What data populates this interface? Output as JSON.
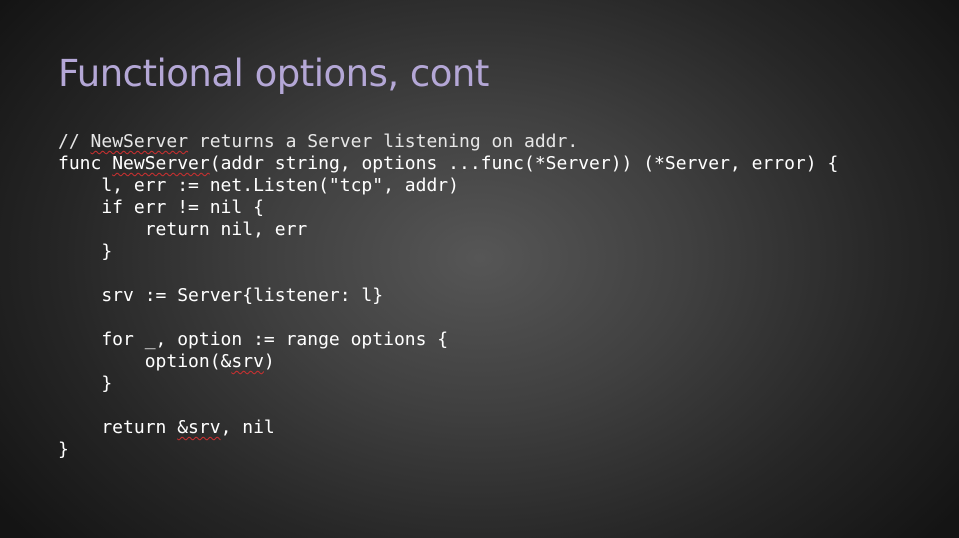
{
  "slide": {
    "title": "Functional options, cont"
  },
  "code": {
    "lines": [
      {
        "parts": [
          {
            "text": "// ",
            "spell": false
          },
          {
            "text": "NewServer",
            "spell": true
          },
          {
            "text": " returns a Server listening on addr.",
            "spell": false
          }
        ]
      },
      {
        "parts": [
          {
            "text": "func ",
            "spell": false
          },
          {
            "text": "NewServer",
            "spell": true
          },
          {
            "text": "(addr string, options ...func(*Server)) (*Server, error) {",
            "spell": false
          }
        ]
      },
      {
        "parts": [
          {
            "text": "    l, err := net.Listen(\"tcp\", addr)",
            "spell": false
          }
        ]
      },
      {
        "parts": [
          {
            "text": "    if err != nil {",
            "spell": false
          }
        ]
      },
      {
        "parts": [
          {
            "text": "        return nil, err",
            "spell": false
          }
        ]
      },
      {
        "parts": [
          {
            "text": "    }",
            "spell": false
          }
        ]
      },
      {
        "parts": [
          {
            "text": "",
            "spell": false
          }
        ]
      },
      {
        "parts": [
          {
            "text": "    srv := Server{listener: l}",
            "spell": false
          }
        ]
      },
      {
        "parts": [
          {
            "text": "",
            "spell": false
          }
        ]
      },
      {
        "parts": [
          {
            "text": "    for _, option := range options {",
            "spell": false
          }
        ]
      },
      {
        "parts": [
          {
            "text": "        option(&",
            "spell": false
          },
          {
            "text": "srv",
            "spell": true
          },
          {
            "text": ")",
            "spell": false
          }
        ]
      },
      {
        "parts": [
          {
            "text": "    }",
            "spell": false
          }
        ]
      },
      {
        "parts": [
          {
            "text": "",
            "spell": false
          }
        ]
      },
      {
        "parts": [
          {
            "text": "    return ",
            "spell": false
          },
          {
            "text": "&srv",
            "spell": true
          },
          {
            "text": ", nil",
            "spell": false
          }
        ]
      },
      {
        "parts": [
          {
            "text": "}",
            "spell": false
          }
        ]
      }
    ]
  },
  "colors": {
    "title": "#b4a7d6",
    "code_text": "#ffffff",
    "spellcheck_underline": "#d03030",
    "background_center": "#565656",
    "background_edge": "#141414"
  }
}
